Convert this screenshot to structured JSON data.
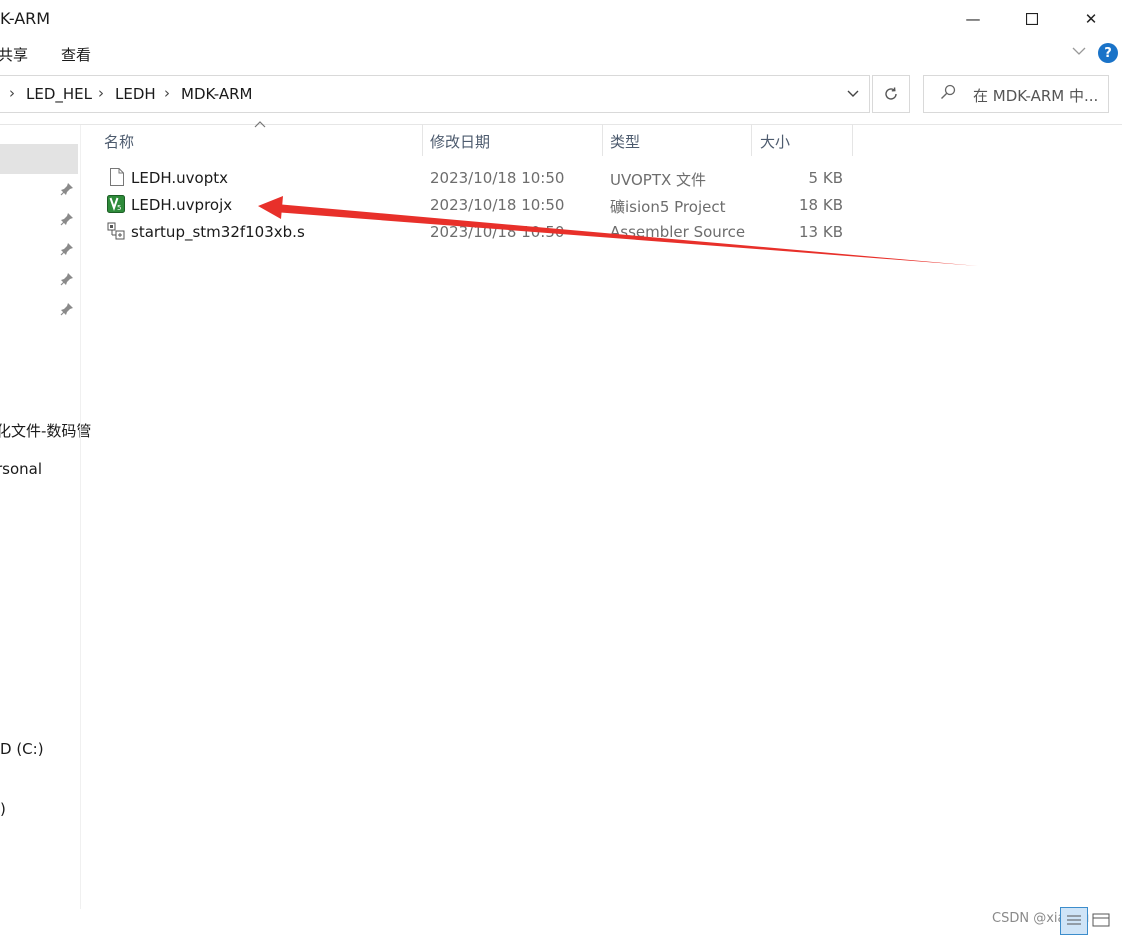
{
  "window": {
    "title": "K-ARM",
    "minimize_glyph": "—",
    "close_glyph": "✕"
  },
  "ribbon": {
    "tabs": [
      "共享",
      "查看"
    ],
    "help_glyph": "?"
  },
  "address": {
    "breadcrumbs": [
      "LED_HEL",
      "LEDH",
      "MDK-ARM"
    ],
    "separator": "›"
  },
  "search": {
    "placeholder": "在 MDK-ARM 中..."
  },
  "nav": {
    "items": [
      "化文件-数码管",
      "rsonal",
      "D (C:)",
      ")"
    ]
  },
  "columns": {
    "name": "名称",
    "date": "修改日期",
    "type": "类型",
    "size": "大小"
  },
  "files": [
    {
      "name": "LEDH.uvoptx",
      "date": "2023/10/18 10:50",
      "type": "UVOPTX 文件",
      "size": "5 KB",
      "icon": "blank-document-icon"
    },
    {
      "name": "LEDH.uvprojx",
      "date": "2023/10/18 10:50",
      "type": "礦ision5 Project",
      "size": "18 KB",
      "icon": "uvision-project-icon"
    },
    {
      "name": "startup_stm32f103xb.s",
      "date": "2023/10/18 10:50",
      "type": "Assembler Source",
      "size": "13 KB",
      "icon": "assembler-source-icon"
    }
  ],
  "watermark": {
    "text": "CSDN @xiaoyu"
  },
  "colors": {
    "annotation_arrow": "#e8302a",
    "accent": "#1a73c8",
    "column_header_text": "#4d5b6e"
  }
}
